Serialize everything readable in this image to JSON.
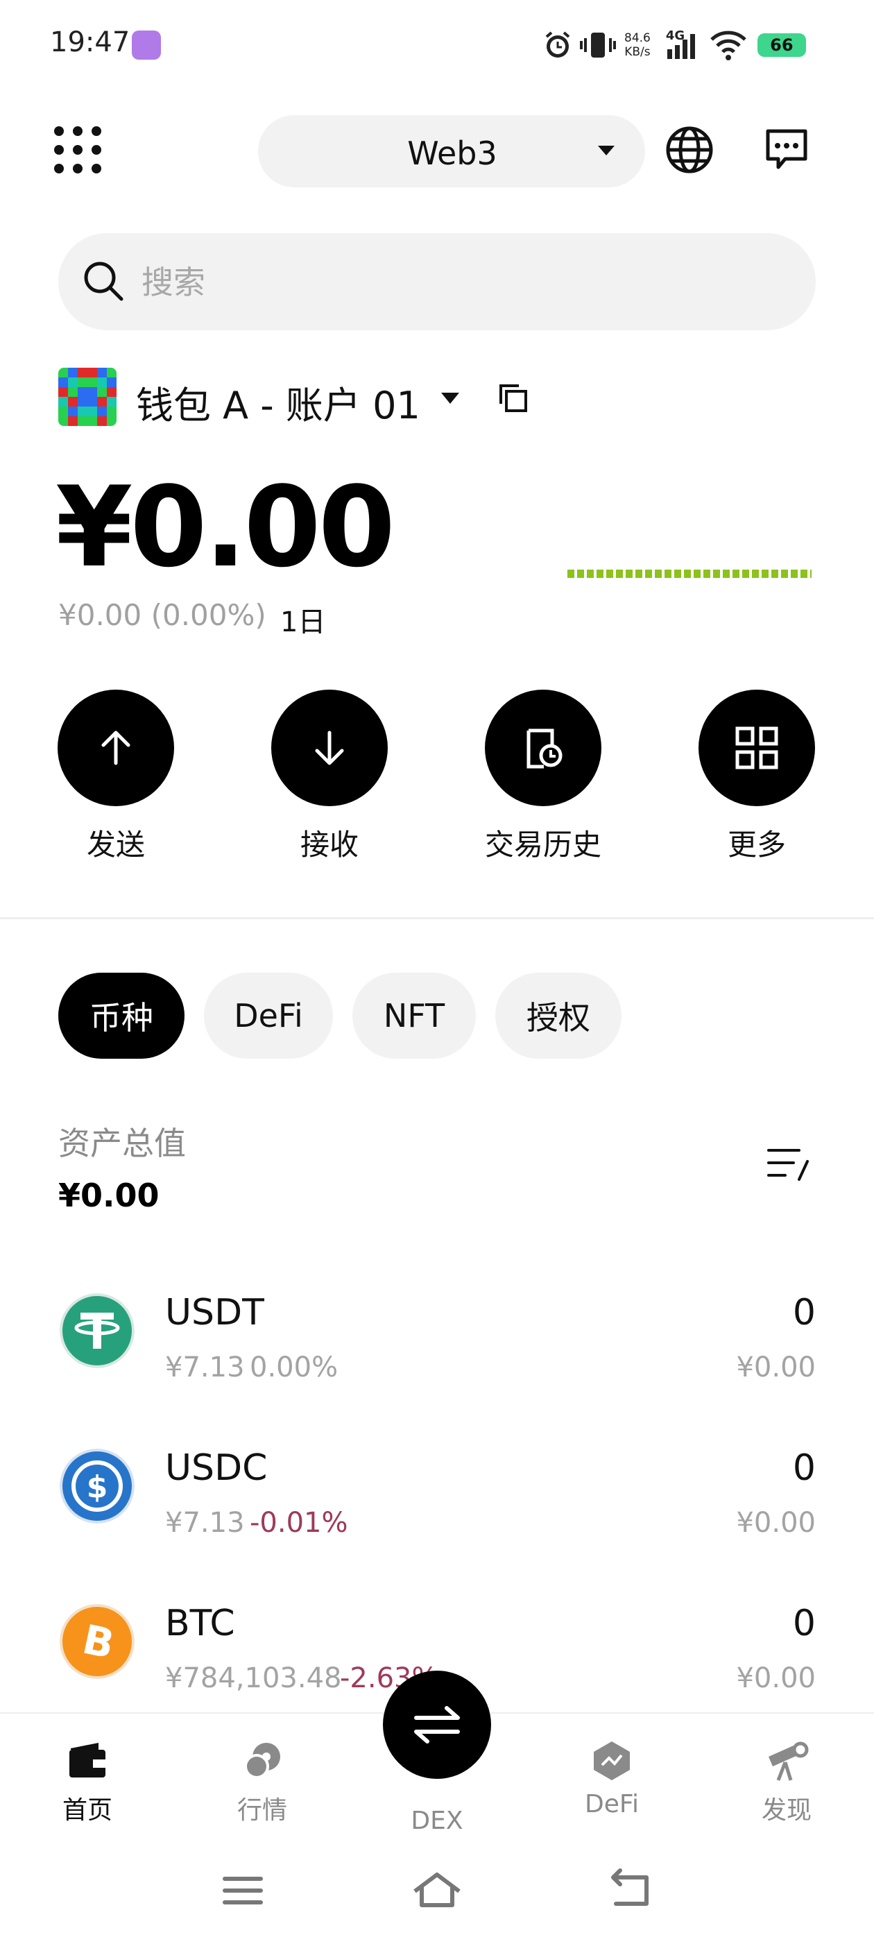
{
  "status_bar": {
    "time": "19:47",
    "net_speed_value": "84.6",
    "net_speed_unit": "KB/s",
    "network": "4G",
    "battery": "66"
  },
  "header": {
    "network_selector": "Web3"
  },
  "search": {
    "placeholder": "搜索"
  },
  "wallet": {
    "name": "钱包 A - 账户 01",
    "balance": "¥0.00",
    "change": "¥0.00 (0.00%)",
    "period": "1日"
  },
  "actions": [
    {
      "label": "发送",
      "icon": "arrow-up-icon"
    },
    {
      "label": "接收",
      "icon": "arrow-down-icon"
    },
    {
      "label": "交易历史",
      "icon": "history-icon"
    },
    {
      "label": "更多",
      "icon": "grid-icon"
    }
  ],
  "asset_tabs": [
    "币种",
    "DeFi",
    "NFT",
    "授权"
  ],
  "assets_summary": {
    "label": "资产总值",
    "value": "¥0.00"
  },
  "assets": [
    {
      "symbol": "USDT",
      "price": "¥7.13",
      "change": "0.00%",
      "change_color": "#a3a3a3",
      "quantity": "0",
      "value": "¥0.00",
      "icon_color": "#26a17b"
    },
    {
      "symbol": "USDC",
      "price": "¥7.13",
      "change": "-0.01%",
      "change_color": "#9e3a5a",
      "quantity": "0",
      "value": "¥0.00",
      "icon_color": "#2775ca"
    },
    {
      "symbol": "BTC",
      "price": "¥784,103.48",
      "change": "-2.63%",
      "change_color": "#9e3a5a",
      "quantity": "0",
      "value": "¥0.00",
      "icon_color": "#f7931a"
    }
  ],
  "bottom_nav": [
    {
      "label": "首页",
      "icon": "wallet-icon"
    },
    {
      "label": "行情",
      "icon": "market-icon"
    },
    {
      "label": "DEX",
      "icon": "swap-icon"
    },
    {
      "label": "DeFi",
      "icon": "defi-icon"
    },
    {
      "label": "发现",
      "icon": "discover-icon"
    }
  ],
  "colors": {
    "sparkline": "#8cc21a",
    "accent": "#000000"
  }
}
